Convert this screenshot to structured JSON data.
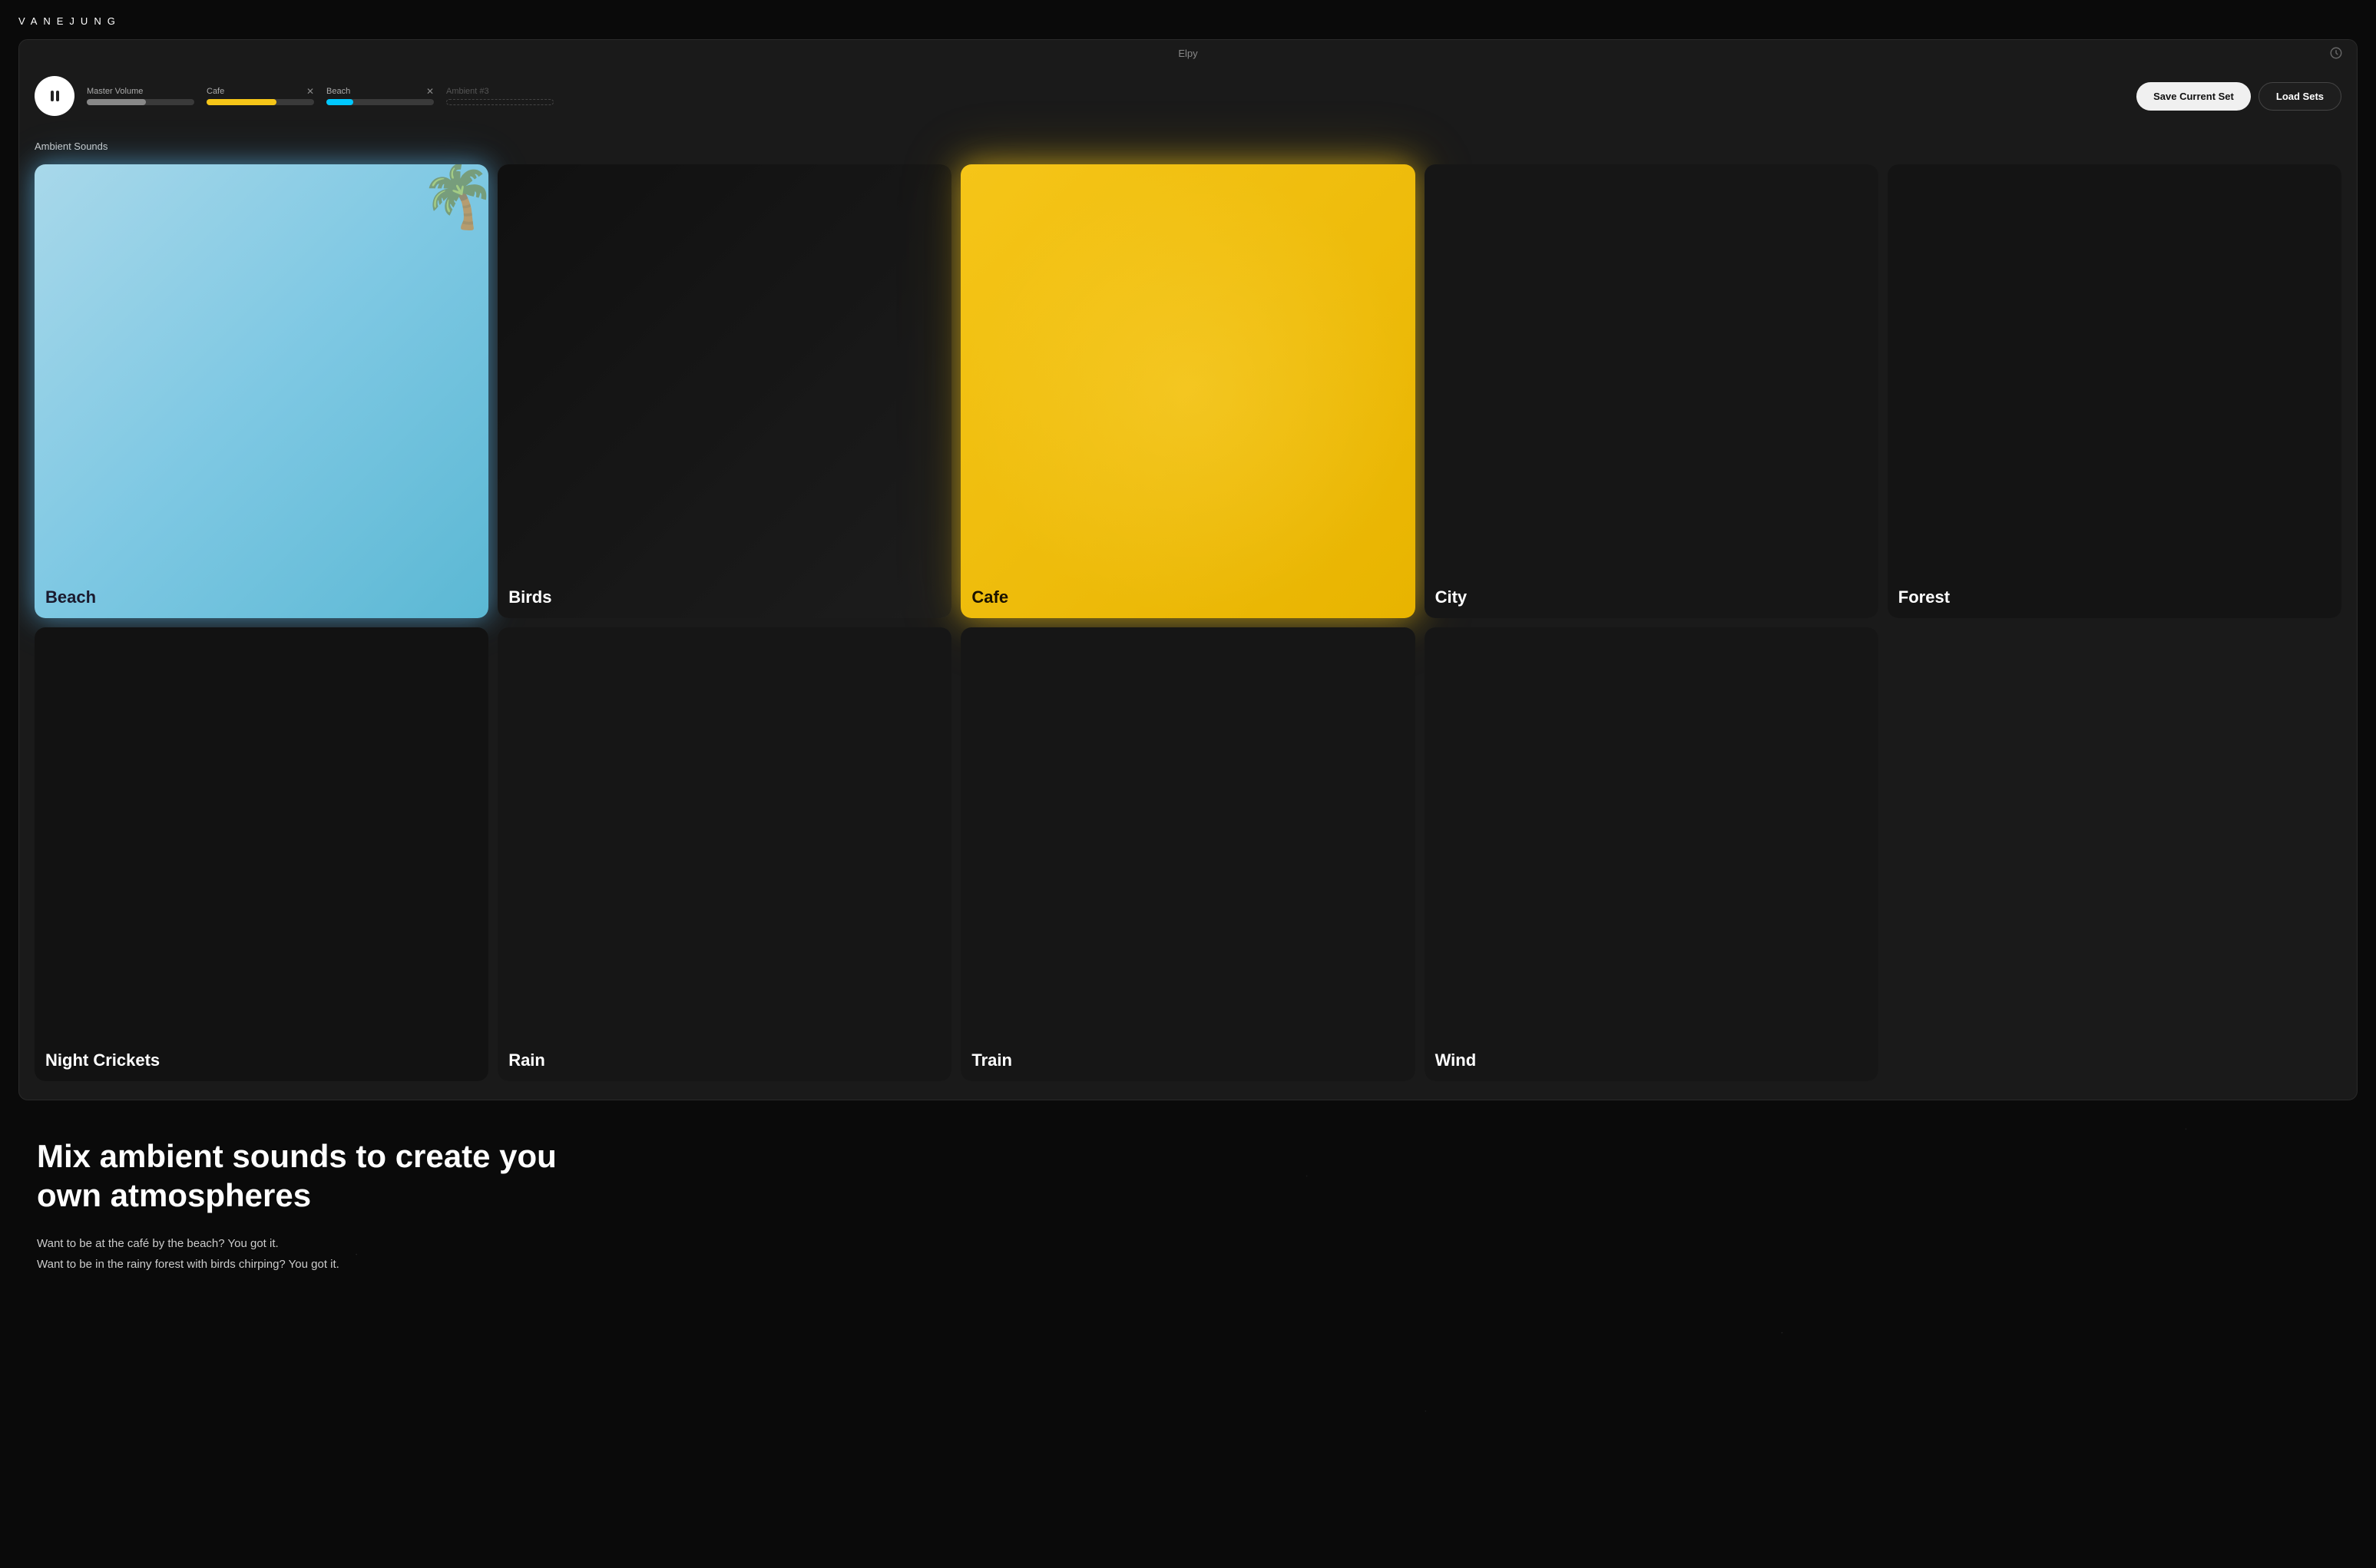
{
  "brand": {
    "name": "VANEJUNG"
  },
  "window": {
    "title": "Elpy"
  },
  "controls": {
    "master_volume_label": "Master Volume",
    "cafe_label": "Cafe",
    "beach_label": "Beach",
    "ambient3_label": "Ambient #3",
    "save_button": "Save Current Set",
    "load_button": "Load Sets"
  },
  "sounds": {
    "section_label": "Ambient Sounds",
    "cards": [
      {
        "id": "beach",
        "label": "Beach",
        "state": "active-blue"
      },
      {
        "id": "birds",
        "label": "Birds",
        "state": "inactive"
      },
      {
        "id": "cafe",
        "label": "Cafe",
        "state": "active-yellow"
      },
      {
        "id": "city",
        "label": "City",
        "state": "inactive"
      },
      {
        "id": "forest",
        "label": "Forest",
        "state": "inactive"
      },
      {
        "id": "night-crickets",
        "label": "Night Crickets",
        "state": "inactive"
      },
      {
        "id": "rain",
        "label": "Rain",
        "state": "inactive"
      },
      {
        "id": "train",
        "label": "Train",
        "state": "inactive"
      },
      {
        "id": "wind",
        "label": "Wind",
        "state": "inactive"
      }
    ]
  },
  "marketing": {
    "tagline": "Mix ambient sounds to create you own atmospheres",
    "desc_line1": "Want to be at the café by the beach? You got it.",
    "desc_line2": "Want to be in the rainy forest with birds chirping? You got it."
  }
}
